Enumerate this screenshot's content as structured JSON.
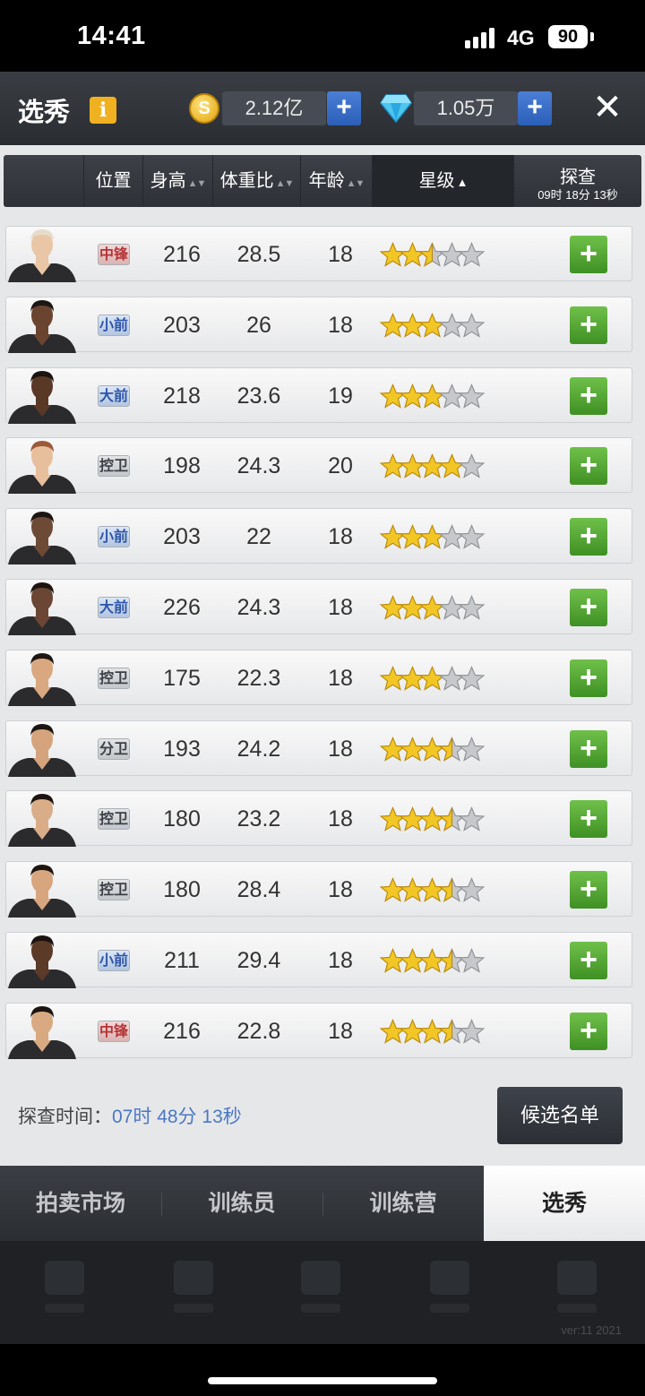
{
  "status_bar": {
    "time": "14:41",
    "network": "4G",
    "battery": "90"
  },
  "header": {
    "title": "选秀",
    "info_glyph": "i",
    "coins": "2.12亿",
    "gems": "1.05万",
    "add_glyph": "+",
    "close_glyph": "✕"
  },
  "table_header": {
    "position": "位置",
    "height": "身高",
    "weight_ratio": "体重比",
    "age": "年龄",
    "stars": "星级",
    "scout_label": "探查",
    "scout_timer": "09时 18分 13秒",
    "sort_both": "▲▼",
    "sort_up": "▲"
  },
  "players": [
    {
      "position": "中锋",
      "pos_type": "c",
      "height": "216",
      "weight_ratio": "28.5",
      "age": "18",
      "stars": 2.5
    },
    {
      "position": "小前",
      "pos_type": "f",
      "height": "203",
      "weight_ratio": "26",
      "age": "18",
      "stars": 3
    },
    {
      "position": "大前",
      "pos_type": "f",
      "height": "218",
      "weight_ratio": "23.6",
      "age": "19",
      "stars": 3
    },
    {
      "position": "控卫",
      "pos_type": "g",
      "height": "198",
      "weight_ratio": "24.3",
      "age": "20",
      "stars": 4
    },
    {
      "position": "小前",
      "pos_type": "f",
      "height": "203",
      "weight_ratio": "22",
      "age": "18",
      "stars": 3
    },
    {
      "position": "大前",
      "pos_type": "f",
      "height": "226",
      "weight_ratio": "24.3",
      "age": "18",
      "stars": 3
    },
    {
      "position": "控卫",
      "pos_type": "g",
      "height": "175",
      "weight_ratio": "22.3",
      "age": "18",
      "stars": 3
    },
    {
      "position": "分卫",
      "pos_type": "g",
      "height": "193",
      "weight_ratio": "24.2",
      "age": "18",
      "stars": 3.5
    },
    {
      "position": "控卫",
      "pos_type": "g",
      "height": "180",
      "weight_ratio": "23.2",
      "age": "18",
      "stars": 3.5
    },
    {
      "position": "控卫",
      "pos_type": "g",
      "height": "180",
      "weight_ratio": "28.4",
      "age": "18",
      "stars": 3.5
    },
    {
      "position": "小前",
      "pos_type": "f",
      "height": "211",
      "weight_ratio": "29.4",
      "age": "18",
      "stars": 3.5
    },
    {
      "position": "中锋",
      "pos_type": "c",
      "height": "216",
      "weight_ratio": "22.8",
      "age": "18",
      "stars": 3.5
    }
  ],
  "footer": {
    "scout_time_label": "探查时间：",
    "scout_time_value": "07时 48分 13秒",
    "candidates_button": "候选名单"
  },
  "tabs": [
    "拍卖市场",
    "训练员",
    "训练营",
    "选秀"
  ],
  "version": "ver:11  2021",
  "colors": {
    "add_green": "#4fa52f",
    "plus_blue": "#3a6fc8",
    "link_blue": "#4a78c4",
    "star_gold": "#f2c624",
    "star_grey": "#b8bbbf"
  }
}
